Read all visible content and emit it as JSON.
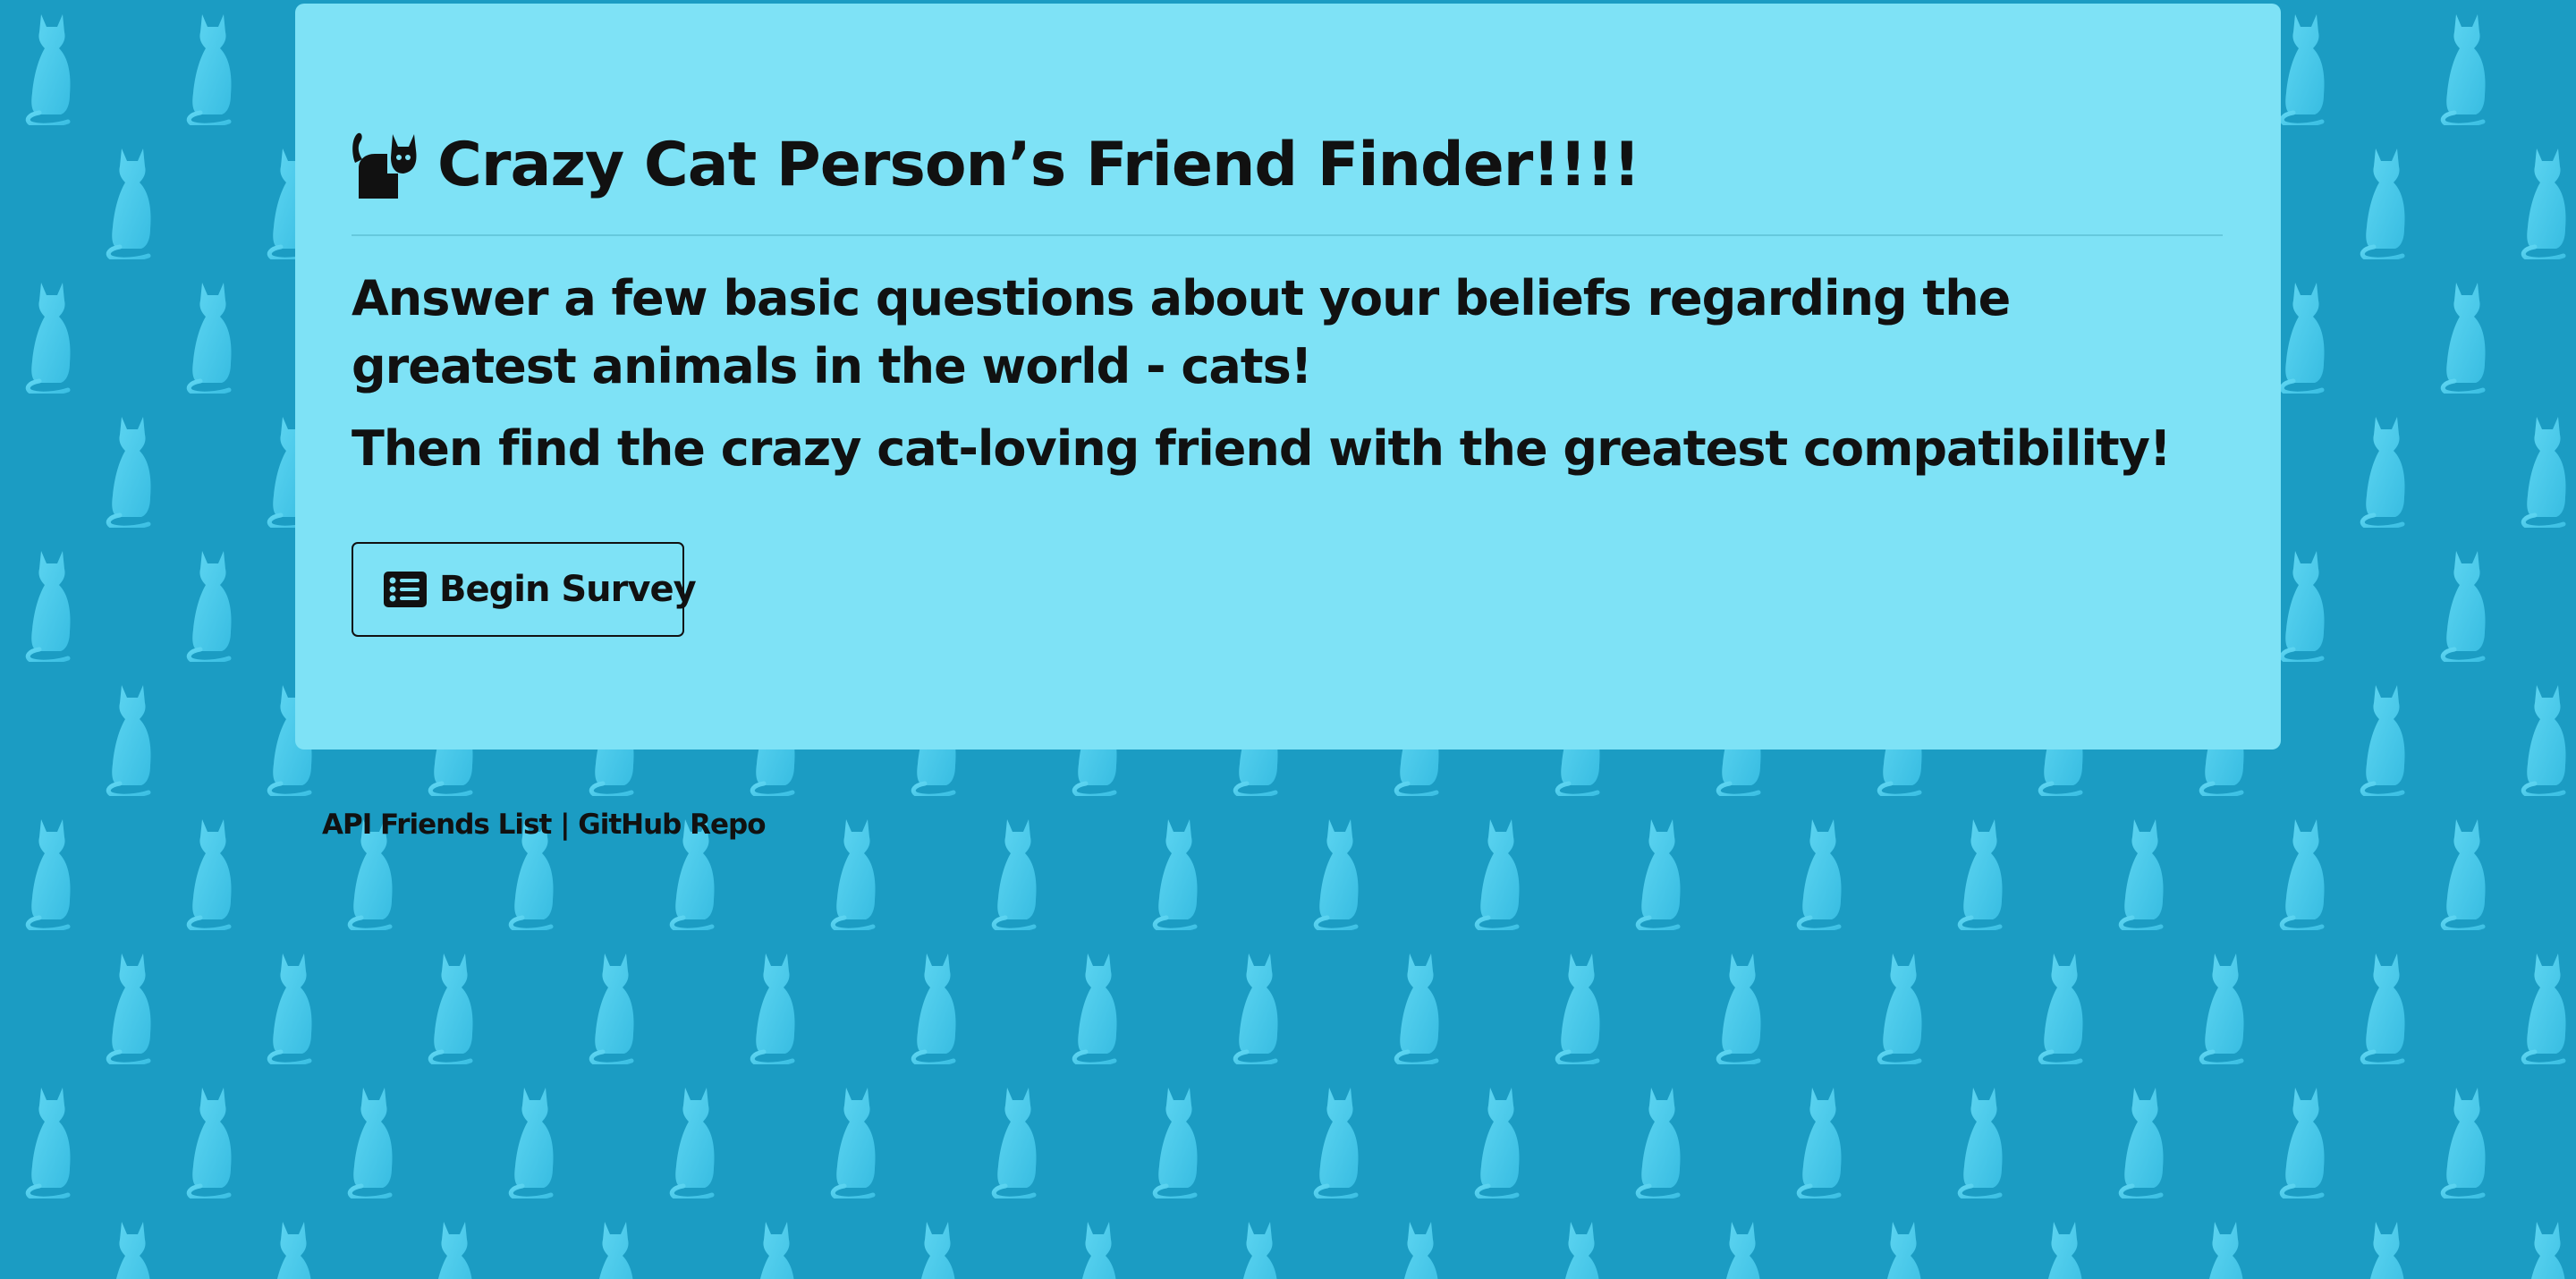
{
  "colors": {
    "background": "#1b9cc3",
    "cat_pattern": "#4ccbec",
    "panel": "#7ee2f6",
    "text": "#111111"
  },
  "header": {
    "icon": "cat-icon",
    "title": "Crazy Cat Person’s Friend Finder!!!!"
  },
  "intro": {
    "line1": "Answer a few basic questions about your beliefs regarding the greatest animals in the world - cats!",
    "line2": "Then find the crazy cat-loving friend with the greatest compatibility!"
  },
  "survey_button": {
    "icon": "list-icon",
    "label": "Begin Survey"
  },
  "footer": {
    "link1": "API Friends List",
    "separator": "|",
    "link2": "GitHub Repo"
  }
}
